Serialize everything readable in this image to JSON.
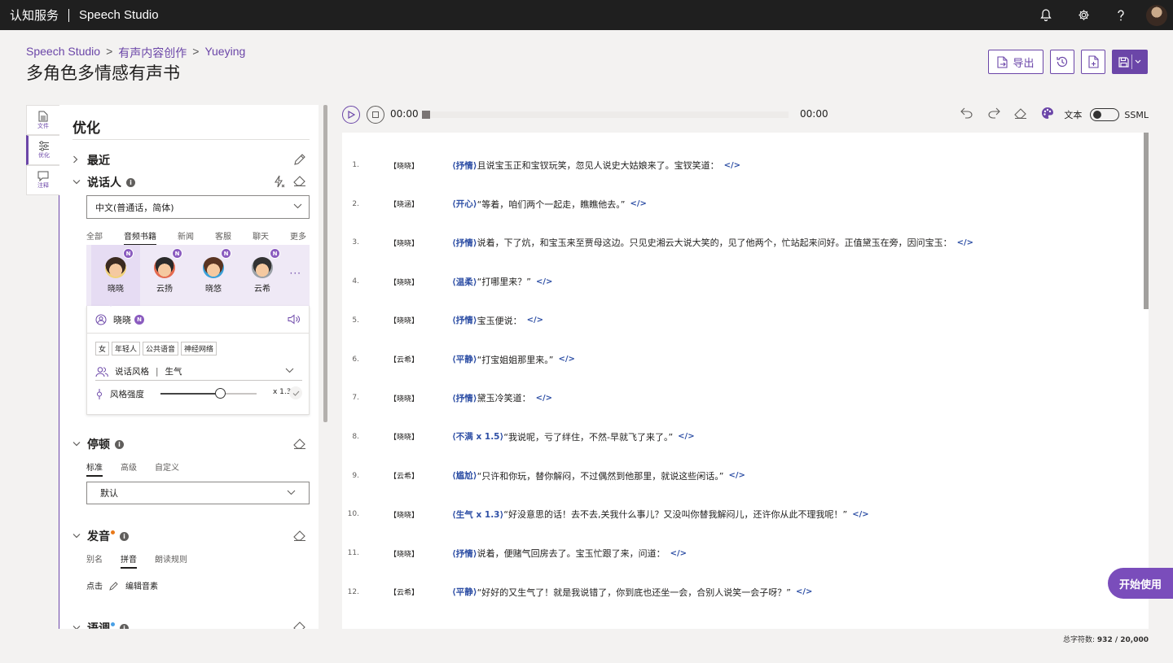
{
  "topbar": {
    "brand": "认知服务",
    "product": "Speech Studio",
    "icons": [
      "bell-icon",
      "gear-icon",
      "help-icon"
    ]
  },
  "breadcrumb": [
    "Speech Studio",
    "有声内容创作",
    "Yueying"
  ],
  "page_title": "多角色多情感有声书",
  "header_actions": {
    "export_label": "导出",
    "icons": [
      "history-icon",
      "new-file-icon",
      "save-icon"
    ]
  },
  "rail": [
    {
      "label": "文件",
      "icon": "file-icon"
    },
    {
      "label": "优化",
      "icon": "sliders-icon"
    },
    {
      "label": "注释",
      "icon": "comment-icon"
    }
  ],
  "panel": {
    "title": "优化",
    "recent": "最近",
    "speaker": {
      "title": "说话人",
      "language": "中文(普通话，简体)",
      "tabs": [
        "全部",
        "音频书籍",
        "新闻",
        "客服",
        "聊天",
        "更多"
      ],
      "active_tab": "音频书籍",
      "voices": [
        {
          "name": "晓晓",
          "badge": "N"
        },
        {
          "name": "云扬",
          "badge": "N"
        },
        {
          "name": "晓悠",
          "badge": "N"
        },
        {
          "name": "云希",
          "badge": "N"
        }
      ],
      "selected_voice": "晓晓",
      "selected_badge": "N",
      "tags": [
        "女",
        "年轻人",
        "公共语音",
        "神经网络"
      ],
      "style_label": "说话风格",
      "style_value": "生气",
      "intensity_label": "风格强度",
      "intensity_value": "x 1.3",
      "intensity_fraction": 0.62
    },
    "pause": {
      "title": "停顿",
      "tabs": [
        "标准",
        "高级",
        "自定义"
      ],
      "active_tab": "标准",
      "value": "默认"
    },
    "pronunciation": {
      "title": "发音",
      "tabs": [
        "别名",
        "拼音",
        "朗读规则"
      ],
      "active_tab": "拼音",
      "action_prefix": "点击",
      "action_label": "编辑音素"
    },
    "tone": {
      "title": "语调"
    }
  },
  "player": {
    "current_time": "00:00",
    "total_time": "00:00",
    "text_label": "文本",
    "ssml_label": "SSML"
  },
  "lines": [
    {
      "n": "1.",
      "speaker": "【晓晓】",
      "emotion": "⟨抒情⟩",
      "text": "且说宝玉正和宝钗玩笑，忽见人说史大姑娘来了。宝钗笑道："
    },
    {
      "n": "2.",
      "speaker": "【晓涵】",
      "emotion": "⟨开心⟩",
      "text": "“等着，咱们两个一起走，瞧瞧他去。”"
    },
    {
      "n": "3.",
      "speaker": "【晓晓】",
      "emotion": "⟨抒情⟩",
      "text": "说着，下了炕，和宝玉来至贾母这边。只见史湘云大说大笑的，见了他两个，忙站起来问好。正值黛玉在旁，因问宝玉："
    },
    {
      "n": "4.",
      "speaker": "【晓晓】",
      "emotion": "⟨温柔⟩",
      "text": "“打哪里来？”"
    },
    {
      "n": "5.",
      "speaker": "【晓晓】",
      "emotion": "⟨抒情⟩",
      "text": "宝玉便说："
    },
    {
      "n": "6.",
      "speaker": "【云希】",
      "emotion": "⟨平静⟩",
      "text": "“打宝姐姐那里来。”"
    },
    {
      "n": "7.",
      "speaker": "【晓晓】",
      "emotion": "⟨抒情⟩",
      "text": "黛玉冷笑道："
    },
    {
      "n": "8.",
      "speaker": "【晓晓】",
      "emotion": "⟨不满 x 1.5⟩",
      "text": "“我说呢，亏了绊住，不然-早就飞了来了。”"
    },
    {
      "n": "9.",
      "speaker": "【云希】",
      "emotion": "⟨尴尬⟩",
      "text": "“只许和你玩，替你解闷，不过偶然到他那里，就说这些闲话。”"
    },
    {
      "n": "10.",
      "speaker": "【晓晓】",
      "emotion": "⟨生气 x 1.3⟩",
      "text": "“好没意思的话！去不去,关我什么事儿？又没叫你替我解闷儿，还许你从此不理我呢！”"
    },
    {
      "n": "11.",
      "speaker": "【晓晓】",
      "emotion": "⟨抒情⟩",
      "text": "说着，便赌气回房去了。宝玉忙跟了来，问道："
    },
    {
      "n": "12.",
      "speaker": "【云希】",
      "emotion": "⟨平静⟩",
      "text": "“好好的又生气了！就是我说错了，你到底也还坐一会，合别人说笑一会子呀？”"
    }
  ],
  "end_tag": "</>",
  "footer": {
    "count_label": "总字符数:",
    "count_value": "932 / 20,000"
  },
  "start_button": "开始使用",
  "colors": {
    "accent": "#6b46a8",
    "emotion": "#2e4fa5",
    "topbar": "#1f1f1f"
  }
}
